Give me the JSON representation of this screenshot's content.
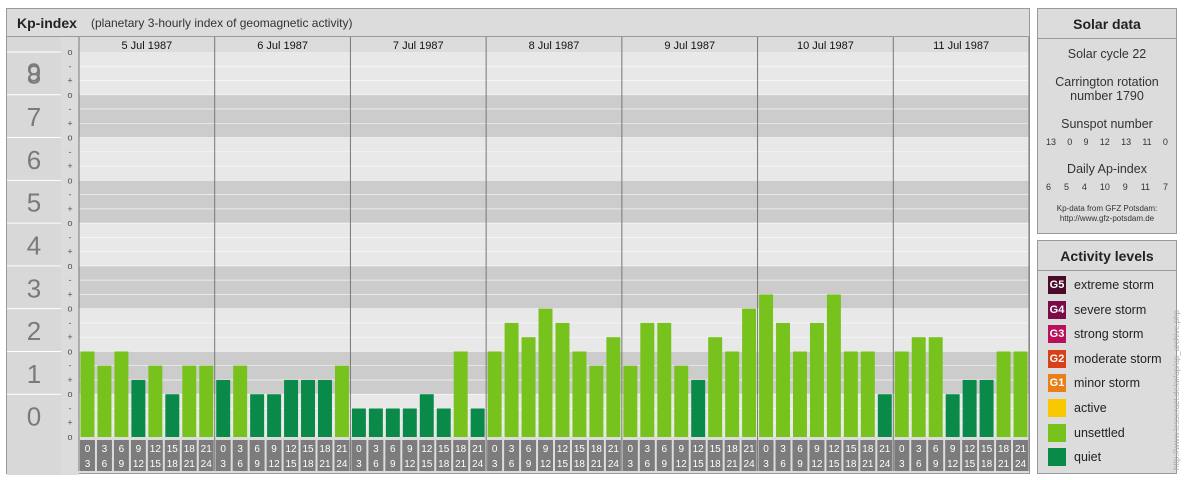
{
  "header": {
    "title": "Kp-index",
    "subtitle": "(planetary 3-hourly index of geomagnetic activity)"
  },
  "chart_data": {
    "type": "bar",
    "title": "Kp-index",
    "subtitle": "(planetary 3-hourly index of geomagnetic activity)",
    "ylim": [
      0,
      9
    ],
    "y_ticks": [
      "0",
      "1",
      "2",
      "3",
      "4",
      "5",
      "6",
      "7",
      "8",
      "9"
    ],
    "y_minor_ticks": [
      "o",
      "+",
      "-",
      "o",
      "+",
      "-",
      "o",
      "+",
      "-",
      "o",
      "+",
      "-",
      "o",
      "+",
      "-",
      "o",
      "+",
      "-",
      "o",
      "+",
      "-",
      "o",
      "+",
      "-",
      "o",
      "+",
      "-",
      "o"
    ],
    "days": [
      "5 Jul 1987",
      "6 Jul 1987",
      "7 Jul 1987",
      "8 Jul 1987",
      "9 Jul 1987",
      "10 Jul 1987",
      "11 Jul 1987"
    ],
    "interval_top": [
      "0",
      "3",
      "6",
      "9",
      "12",
      "15",
      "18",
      "21"
    ],
    "interval_bottom": [
      "3",
      "6",
      "9",
      "12",
      "15",
      "18",
      "21",
      "24"
    ],
    "values": [
      2.0,
      1.667,
      2.0,
      1.333,
      1.667,
      1.0,
      1.667,
      1.667,
      1.333,
      1.667,
      1.0,
      1.0,
      1.333,
      1.333,
      1.333,
      1.667,
      0.667,
      0.667,
      0.667,
      0.667,
      1.0,
      0.667,
      2.0,
      0.667,
      2.0,
      2.667,
      2.333,
      3.0,
      2.667,
      2.0,
      1.667,
      2.333,
      1.667,
      2.667,
      2.667,
      1.667,
      1.333,
      2.333,
      2.0,
      3.0,
      3.333,
      2.667,
      2.0,
      2.667,
      3.333,
      2.0,
      2.0,
      1.0,
      2.0,
      2.333,
      2.333,
      1.0,
      1.333,
      1.333,
      2.0,
      2.0
    ],
    "grid": true,
    "colors": {
      "quiet": "#0a8a48",
      "unsettled": "#78c21e"
    }
  },
  "solar": {
    "title": "Solar data",
    "cycle": "Solar cycle 22",
    "carrington_line1": "Carrington rotation",
    "carrington_line2": "number 1790",
    "sunspot_label": "Sunspot number",
    "sunspot_values": [
      "13",
      "0",
      "9",
      "12",
      "13",
      "11",
      "0"
    ],
    "ap_label": "Daily Ap-index",
    "ap_values": [
      "6",
      "5",
      "4",
      "10",
      "9",
      "11",
      "7"
    ],
    "source_line1": "Kp-data from GFZ Potsdam:",
    "source_line2": "http://www.gfz-potsdam.de"
  },
  "activity": {
    "title": "Activity levels",
    "levels": [
      {
        "code": "G5",
        "label": "extreme storm",
        "color": "#4a0a2a"
      },
      {
        "code": "G4",
        "label": "severe storm",
        "color": "#7a0a4a"
      },
      {
        "code": "G3",
        "label": "strong storm",
        "color": "#b8105a"
      },
      {
        "code": "G2",
        "label": "moderate storm",
        "color": "#d8401a"
      },
      {
        "code": "G1",
        "label": "minor storm",
        "color": "#e8801a"
      },
      {
        "code": "",
        "label": "active",
        "color": "#f8c800"
      },
      {
        "code": "",
        "label": "unsettled",
        "color": "#78c21e"
      },
      {
        "code": "",
        "label": "quiet",
        "color": "#0a8a48"
      }
    ]
  },
  "watermark": "http://www.tesseract.de/ar/ap/ap_archive.php"
}
